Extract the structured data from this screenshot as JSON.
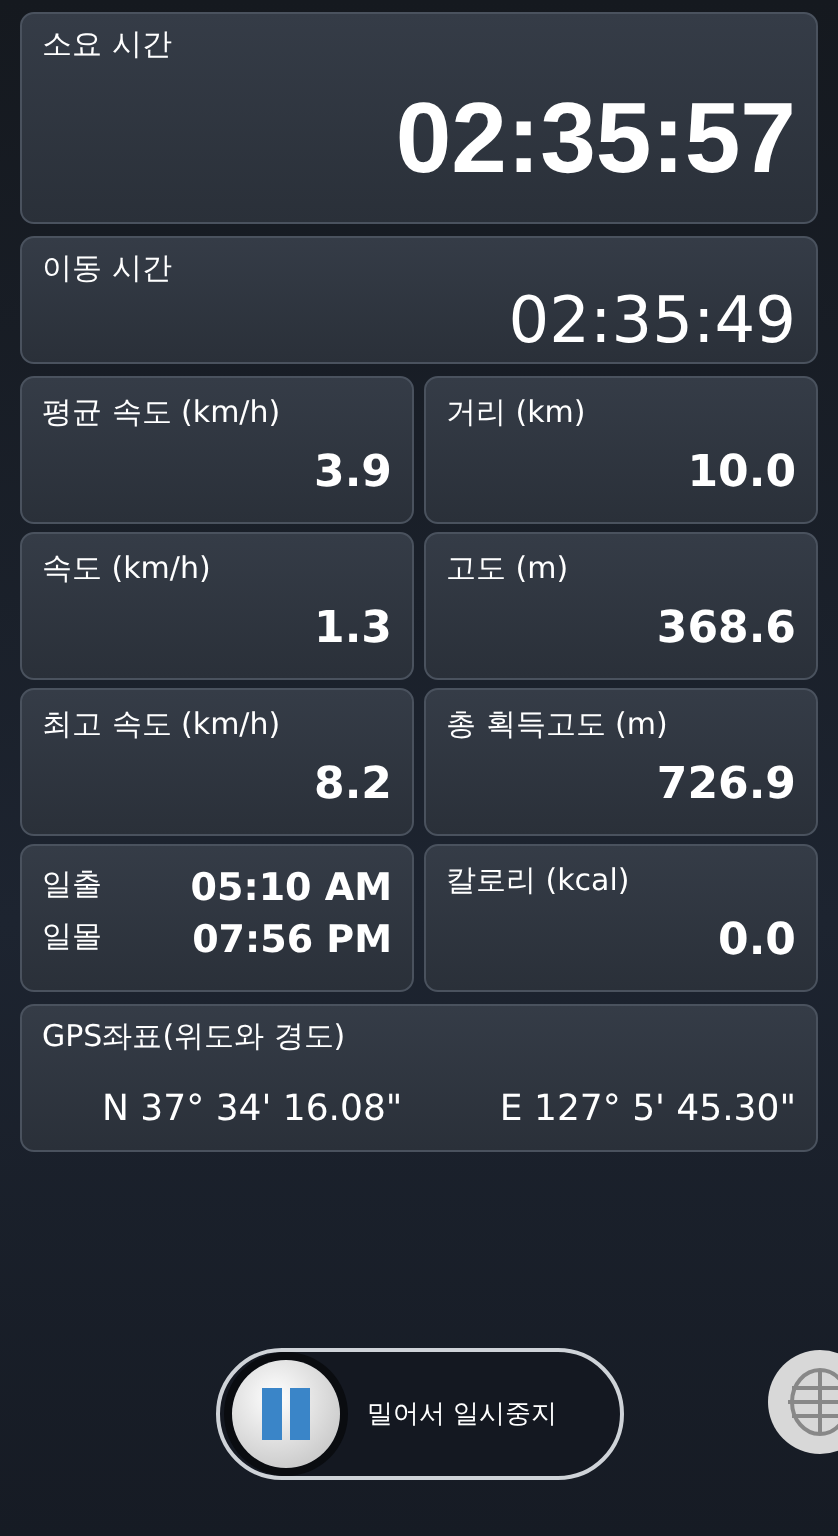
{
  "elapsed": {
    "label": "소요 시간",
    "value": "02:35:57"
  },
  "moving": {
    "label": "이동 시간",
    "value": "02:35:49"
  },
  "stats": [
    {
      "label": "평균 속도 (km/h)",
      "value": "3.9"
    },
    {
      "label": "거리 (km)",
      "value": "10.0"
    },
    {
      "label": "속도 (km/h)",
      "value": "1.3"
    },
    {
      "label": "고도 (m)",
      "value": "368.6"
    },
    {
      "label": "최고 속도 (km/h)",
      "value": "8.2"
    },
    {
      "label": "총 획득고도 (m)",
      "value": "726.9"
    }
  ],
  "sun": [
    {
      "label": "일출",
      "value": "05:10 AM"
    },
    {
      "label": "일몰",
      "value": "07:56 PM"
    }
  ],
  "calories": {
    "label": "칼로리 (kcal)",
    "value": "0.0"
  },
  "gps": {
    "label": "GPS좌표(위도와 경도)",
    "latitude": "N 37° 34' 16.08\"",
    "longitude": "E 127° 5' 45.30\""
  },
  "slider": {
    "label": "밀어서 일시중지",
    "level": 0
  }
}
